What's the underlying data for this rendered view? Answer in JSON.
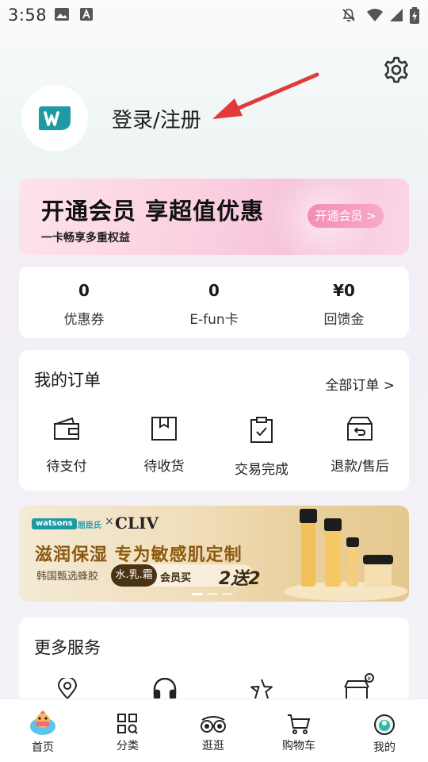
{
  "status_bar": {
    "time": "3:58"
  },
  "profile": {
    "login_text": "登录/注册",
    "logo_letter": "W"
  },
  "member_banner": {
    "title": "开通会员 享超值优惠",
    "subtitle": "一卡畅享多重权益",
    "button": "开通会员 >"
  },
  "stats": [
    {
      "value": "0",
      "label": "优惠券"
    },
    {
      "value": "0",
      "label": "E-fun卡"
    },
    {
      "value": "¥0",
      "label": "回馈金"
    }
  ],
  "orders": {
    "title": "我的订单",
    "view_all": "全部订单 >",
    "items": [
      {
        "label": "待支付",
        "icon": "wallet-icon"
      },
      {
        "label": "待收货",
        "icon": "package-icon"
      },
      {
        "label": "交易完成",
        "icon": "clipboard-check-icon"
      },
      {
        "label": "退款/售后",
        "icon": "return-box-icon"
      }
    ]
  },
  "promo": {
    "brand": "watsons",
    "brand2": "屈臣氏",
    "x": "×",
    "partner": "CLIV",
    "title": "滋润保湿 专为敏感肌定制",
    "subtitle": "韩国甄选蜂胶",
    "tag_dark": "水.乳.霜",
    "tag_text": "会员买",
    "tag_big": "2送2"
  },
  "services": {
    "title": "更多服务"
  },
  "tabs": [
    {
      "label": "首页",
      "icon": "home-mascot-icon"
    },
    {
      "label": "分类",
      "icon": "category-icon"
    },
    {
      "label": "逛逛",
      "icon": "explore-icon"
    },
    {
      "label": "购物车",
      "icon": "cart-icon"
    },
    {
      "label": "我的",
      "icon": "profile-icon"
    }
  ],
  "colors": {
    "brand": "#1e9aa3",
    "member_pink": "#f48db7",
    "arrow": "#e23a3a"
  }
}
